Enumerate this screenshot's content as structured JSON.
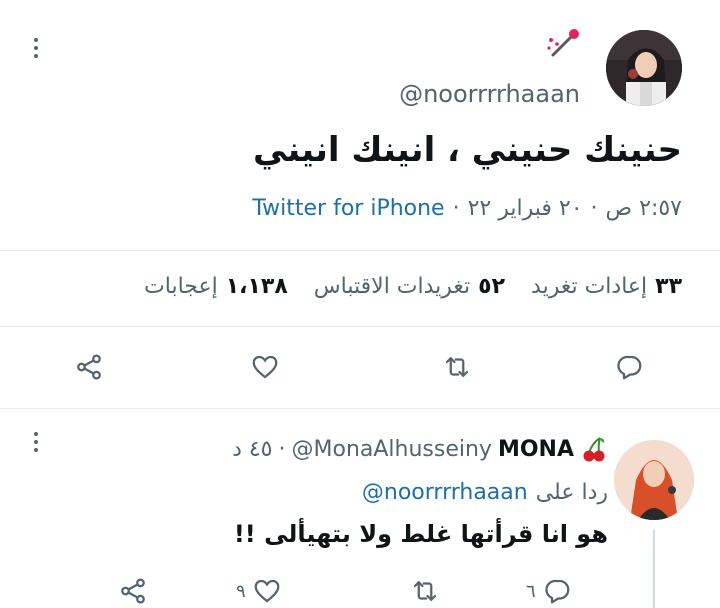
{
  "tweet": {
    "handle": "@noorrrrhaaan",
    "text": "حنينك حنيني ، انينك انيني",
    "time": "٢:٥٧ ص",
    "sep1": "·",
    "date": "٢٠ فبراير ٢٢",
    "sep2": "·",
    "source": "Twitter for iPhone",
    "stats": {
      "retweets_count": "٣٣",
      "retweets_label": "إعادات تغريد",
      "quotes_count": "٥٢",
      "quotes_label": "تغريدات الاقتباس",
      "likes_count": "١،١٣٨",
      "likes_label": "إعجابات"
    }
  },
  "reply": {
    "name": "MONA",
    "handle": "@MonaAlhusseiny",
    "sep": "·",
    "time": "٤٥ د",
    "replying_prefix": "ردا على",
    "replying_to": "@noorrrrhaaan",
    "text": "هو انا قرأتها غلط ولا بتهيألى !!",
    "reply_count": "٦",
    "like_count": "٩"
  },
  "colors": {
    "accent_link": "#1d6fa5",
    "muted": "#536471",
    "divider": "#e6ecf0",
    "cherry": "#d32026"
  }
}
